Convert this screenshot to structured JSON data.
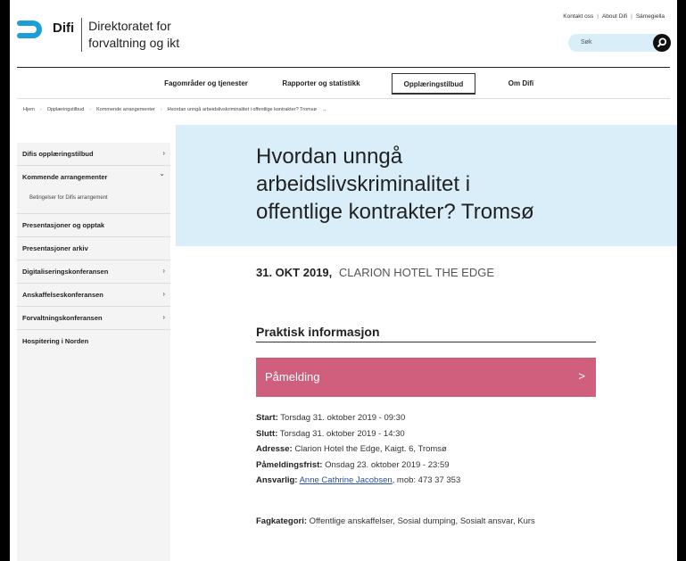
{
  "header": {
    "logo_text": "Difi",
    "org_name_line1": "Direktoratet for",
    "org_name_line2": "forvaltning og ikt",
    "brand_color": "#1a9fd9",
    "top_links": [
      "Kontakt oss",
      "About Difi",
      "Sámegiella"
    ],
    "top_link_separator": "|",
    "search_placeholder": "Søk"
  },
  "nav": {
    "items": [
      "Fagområder og tjenester",
      "Rapporter og statistikk",
      "Opplæringstilbud",
      "Om Difi"
    ],
    "active_index": 2
  },
  "breadcrumb": {
    "items": [
      "Hjem",
      "Opplæringstilbud",
      "Kommende arrangementer",
      "Hvordan unngå arbeidslivskriminalitet i offentlige kontrakter? Tromsø"
    ],
    "separator": "›",
    "trailing": "→"
  },
  "sidebar": {
    "items": [
      {
        "label": "Difis opplæringstilbud",
        "chevron": "›"
      },
      {
        "label": "Kommende arrangementer",
        "chevron": "⌄"
      },
      {
        "label": "Betingelser for Difis arrangement",
        "chevron": ""
      },
      {
        "label": "Presentasjoner og opptak",
        "chevron": ""
      },
      {
        "label": "Presentasjoner arkiv",
        "chevron": ""
      },
      {
        "label": "Digitaliseringskonferansen",
        "chevron": "›"
      },
      {
        "label": "Anskaffelseskonferansen",
        "chevron": "›"
      },
      {
        "label": "Forvaltningskonferansen",
        "chevron": "›"
      },
      {
        "label": "Hospitering i Norden",
        "chevron": ""
      }
    ]
  },
  "hero": {
    "title_line1": "Hvordan unngå",
    "title_line2": "arbeidslivskriminalitet i",
    "title_line3": "offentlige kontrakter? Tromsø",
    "background": "#d9eef8"
  },
  "event": {
    "date": "31. OKT 2019,",
    "venue": "CLARION HOTEL THE EDGE"
  },
  "practical": {
    "title": "Praktisk informasjon",
    "signup_label": "Påmelding",
    "signup_arrow": ">",
    "signup_color": "#cf5f7c",
    "start_label": "Start:",
    "start_value": "Torsdag 31. oktober 2019 - 09:30",
    "end_label": "Slutt:",
    "end_value": "Torsdag 31. oktober 2019 - 14:30",
    "address_label": "Adresse:",
    "address_value": "Clarion Hotel the Edge, Kaigt. 6, Tromsø",
    "deadline_label": "Påmeldingsfrist:",
    "deadline_value": "Onsdag 23. oktober 2019 - 23:59",
    "responsible_label": "Ansvarlig:",
    "responsible_name": "Anne Cathrine Jacobsen",
    "responsible_suffix": ", mob: 473 37 353",
    "category_label": "Fagkategori:",
    "category_value": "Offentlige anskaffelser,  Sosial dumping,  Sosialt ansvar, Kurs"
  }
}
